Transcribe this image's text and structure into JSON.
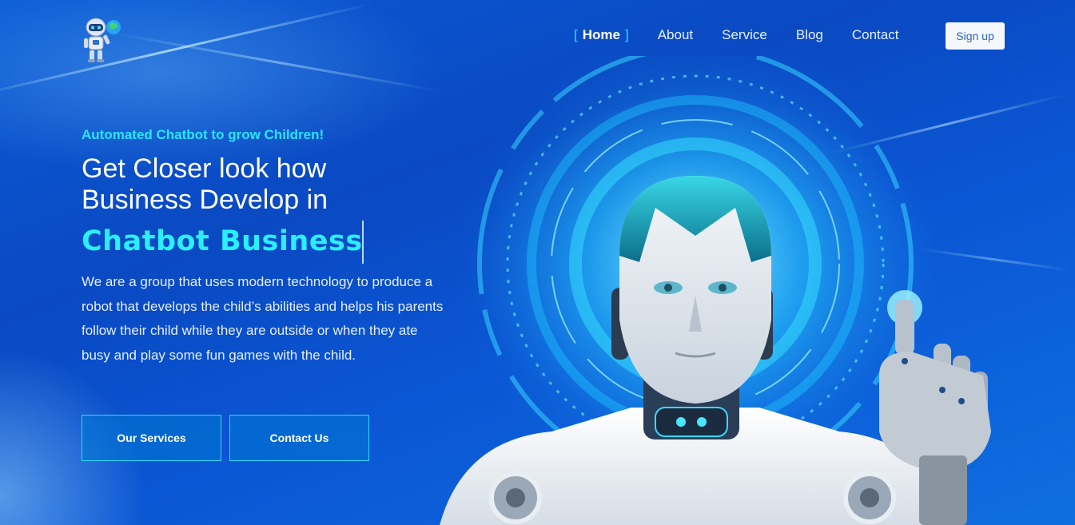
{
  "nav": {
    "items": [
      {
        "label": "Home",
        "active": true
      },
      {
        "label": "About",
        "active": false
      },
      {
        "label": "Service",
        "active": false
      },
      {
        "label": "Blog",
        "active": false
      },
      {
        "label": "Contact",
        "active": false
      }
    ],
    "bracket_left": "[",
    "bracket_right": "]",
    "signup_label": "Sign up"
  },
  "hero": {
    "tagline": "Automated Chatbot to grow Children!",
    "headline_line1": "Get Closer look how",
    "headline_line2": "Business Develop in",
    "highlight": "Chatbot Business",
    "description": "We are a group that uses modern technology to produce a robot that develops the child’s abilities and helps his parents follow their child while they are outside or when they ate busy and play some fun games with the child.",
    "buttons": {
      "services": "Our Services",
      "contact": "Contact Us"
    }
  },
  "colors": {
    "accent": "#29efff",
    "background": "#0a4fc7",
    "button_border": "#2fd8f0",
    "signup_text": "#2b66b8"
  },
  "icons": {
    "logo": "robot-mascot-icon",
    "illustration": "humanoid-robot-illustration"
  }
}
